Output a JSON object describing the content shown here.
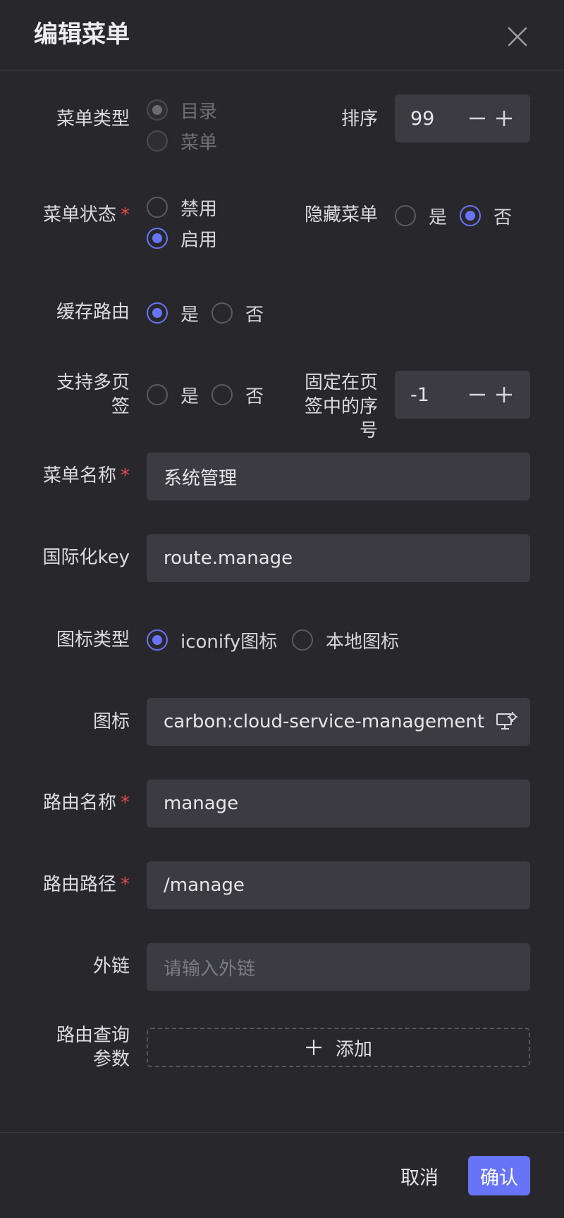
{
  "dialog": {
    "title": "编辑菜单",
    "close_icon": "close-icon"
  },
  "menu_type": {
    "label": "菜单类型",
    "options": [
      "目录",
      "菜单"
    ],
    "selected": "目录",
    "disabled": true
  },
  "order": {
    "label": "排序",
    "value": "99"
  },
  "menu_status": {
    "label": "菜单状态",
    "required": "*",
    "options": [
      "禁用",
      "启用"
    ],
    "selected": "启用"
  },
  "hide_menu": {
    "label": "隐藏菜单",
    "options": [
      "是",
      "否"
    ],
    "selected": "否"
  },
  "cache_route": {
    "label": "缓存路由",
    "options": [
      "是",
      "否"
    ],
    "selected": "是"
  },
  "multi_tab": {
    "label_line1": "支持多页",
    "label_line2": "签",
    "options": [
      "是",
      "否"
    ],
    "selected": "none"
  },
  "fixed_index": {
    "label_line1": "固定在页",
    "label_line2": "签中的序",
    "label_line3": "号",
    "value": "-1"
  },
  "menu_name": {
    "label": "菜单名称",
    "required": "*",
    "value": "系统管理"
  },
  "i18n_key": {
    "label": "国际化key",
    "value": "route.manage"
  },
  "icon_type": {
    "label": "图标类型",
    "options": [
      "iconify图标",
      "本地图标"
    ],
    "selected": "iconify图标"
  },
  "icon": {
    "label": "图标",
    "value": "carbon:cloud-service-management",
    "suffix_icon": "cloud-service-management-icon"
  },
  "route_name": {
    "label": "路由名称",
    "required": "*",
    "value": "manage"
  },
  "route_path": {
    "label": "路由路径",
    "required": "*",
    "value": "/manage"
  },
  "external_link": {
    "label": "外链",
    "placeholder": "请输入外链"
  },
  "route_query": {
    "label_line1": "路由查询",
    "label_line2": "参数",
    "add_label": "添加"
  },
  "footer": {
    "cancel_label": "取消",
    "confirm_label": "确认"
  },
  "colors": {
    "accent": "#6874f7",
    "background": "#28282c",
    "input_bg": "#3b3b41",
    "required": "#e8484a"
  }
}
